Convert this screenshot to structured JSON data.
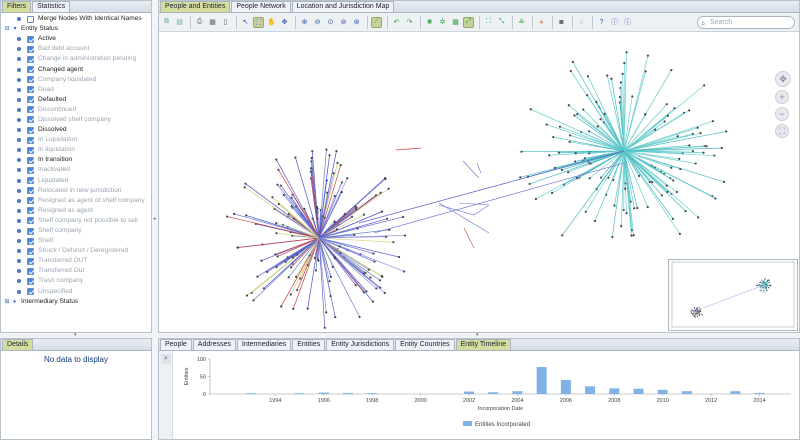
{
  "left_tabs": [
    "Filters",
    "Statistics"
  ],
  "filter_tree": [
    {
      "type": "leaf-unchecked",
      "label": "Merge Nodes With Identical Names",
      "faded": false
    },
    {
      "type": "group-open",
      "label": "Entity Status"
    },
    {
      "type": "leaf",
      "label": "Active",
      "faded": false
    },
    {
      "type": "leaf",
      "label": "Bad debt account",
      "faded": true
    },
    {
      "type": "leaf",
      "label": "Change in administration pending",
      "faded": true
    },
    {
      "type": "leaf",
      "label": "Changed agent",
      "faded": false
    },
    {
      "type": "leaf",
      "label": "Company liquidated",
      "faded": true
    },
    {
      "type": "leaf",
      "label": "Dead",
      "faded": true
    },
    {
      "type": "leaf",
      "label": "Defaulted",
      "faded": false
    },
    {
      "type": "leaf",
      "label": "Discontinued",
      "faded": true
    },
    {
      "type": "leaf",
      "label": "Dissolved shelf company",
      "faded": true
    },
    {
      "type": "leaf",
      "label": "Dissolved",
      "faded": false
    },
    {
      "type": "leaf",
      "label": "In Liquidation",
      "faded": true
    },
    {
      "type": "leaf",
      "label": "In liquidation",
      "faded": true
    },
    {
      "type": "leaf",
      "label": "In transition",
      "faded": false
    },
    {
      "type": "leaf",
      "label": "Inactivated",
      "faded": true
    },
    {
      "type": "leaf",
      "label": "Liquidated",
      "faded": true
    },
    {
      "type": "leaf",
      "label": "Relocated in new jurisdiction",
      "faded": true
    },
    {
      "type": "leaf",
      "label": "Resigned as agent of shelf company",
      "faded": true
    },
    {
      "type": "leaf",
      "label": "Resigned as agent",
      "faded": true
    },
    {
      "type": "leaf",
      "label": "Shelf company not possible to sell",
      "faded": true
    },
    {
      "type": "leaf",
      "label": "Shelf company",
      "faded": true
    },
    {
      "type": "leaf",
      "label": "Shelf",
      "faded": true
    },
    {
      "type": "leaf",
      "label": "Struck / Defunct / Deregistered",
      "faded": true
    },
    {
      "type": "leaf",
      "label": "Transferred OUT",
      "faded": true
    },
    {
      "type": "leaf",
      "label": "Transferred Out",
      "faded": true
    },
    {
      "type": "leaf",
      "label": "Trash company",
      "faded": true
    },
    {
      "type": "leaf",
      "label": "Unspecified",
      "faded": true
    },
    {
      "type": "group-closed",
      "label": "Intermediary Status"
    }
  ],
  "graph_tabs": [
    "People and Entities",
    "People Network",
    "Location and Jurisdiction Map"
  ],
  "search": {
    "placeholder": "Search"
  },
  "details": {
    "tab": "Details",
    "empty_text": "No data to display"
  },
  "bottom_tabs": [
    "People",
    "Addresses",
    "Intermediaries",
    "Entities",
    "Entity Jurisdictions",
    "Entity Countries",
    "Entity Timeline"
  ],
  "chart_data": {
    "type": "bar",
    "xlabel": "Incorporation Date",
    "ylabel": "Entities",
    "ylim": [
      0,
      100
    ],
    "yticks": [
      0,
      50,
      100
    ],
    "xticks": [
      1994,
      1996,
      1998,
      2000,
      2002,
      2004,
      2006,
      2008,
      2010,
      2012,
      2014
    ],
    "series": [
      {
        "name": "Entities Incorporated",
        "color": "#7fb2e5",
        "x": [
          1993,
          1995,
          1996,
          1997,
          1998,
          2002,
          2003,
          2004,
          2005,
          2006,
          2007,
          2008,
          2009,
          2010,
          2011,
          2013,
          2014
        ],
        "values": [
          2,
          1,
          4,
          3,
          2,
          7,
          5,
          8,
          77,
          40,
          22,
          16,
          15,
          12,
          8,
          8,
          3
        ]
      }
    ],
    "legend": "bottom-center"
  }
}
